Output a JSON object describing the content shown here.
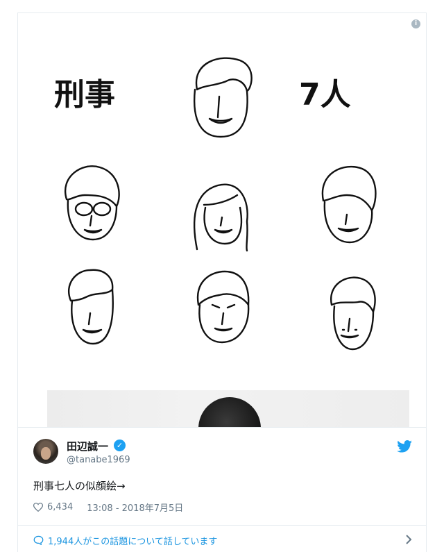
{
  "image": {
    "title_left": "刑事",
    "title_right": "7人"
  },
  "tweet": {
    "name": "田辺誠一",
    "handle": "@tanabe1969",
    "text": "刑事七人の似顔絵→",
    "likes": "6,434",
    "time": "13:08 - 2018年7月5日",
    "conversation": "1,944人がこの話題について話しています"
  },
  "colors": {
    "accent": "#1da1f2",
    "link": "#1b95e0",
    "secondary_text": "#657786"
  },
  "icons": [
    "info-icon",
    "verified-badge-icon",
    "twitter-bird-icon",
    "heart-icon",
    "speech-bubble-icon",
    "chevron-right-icon"
  ]
}
